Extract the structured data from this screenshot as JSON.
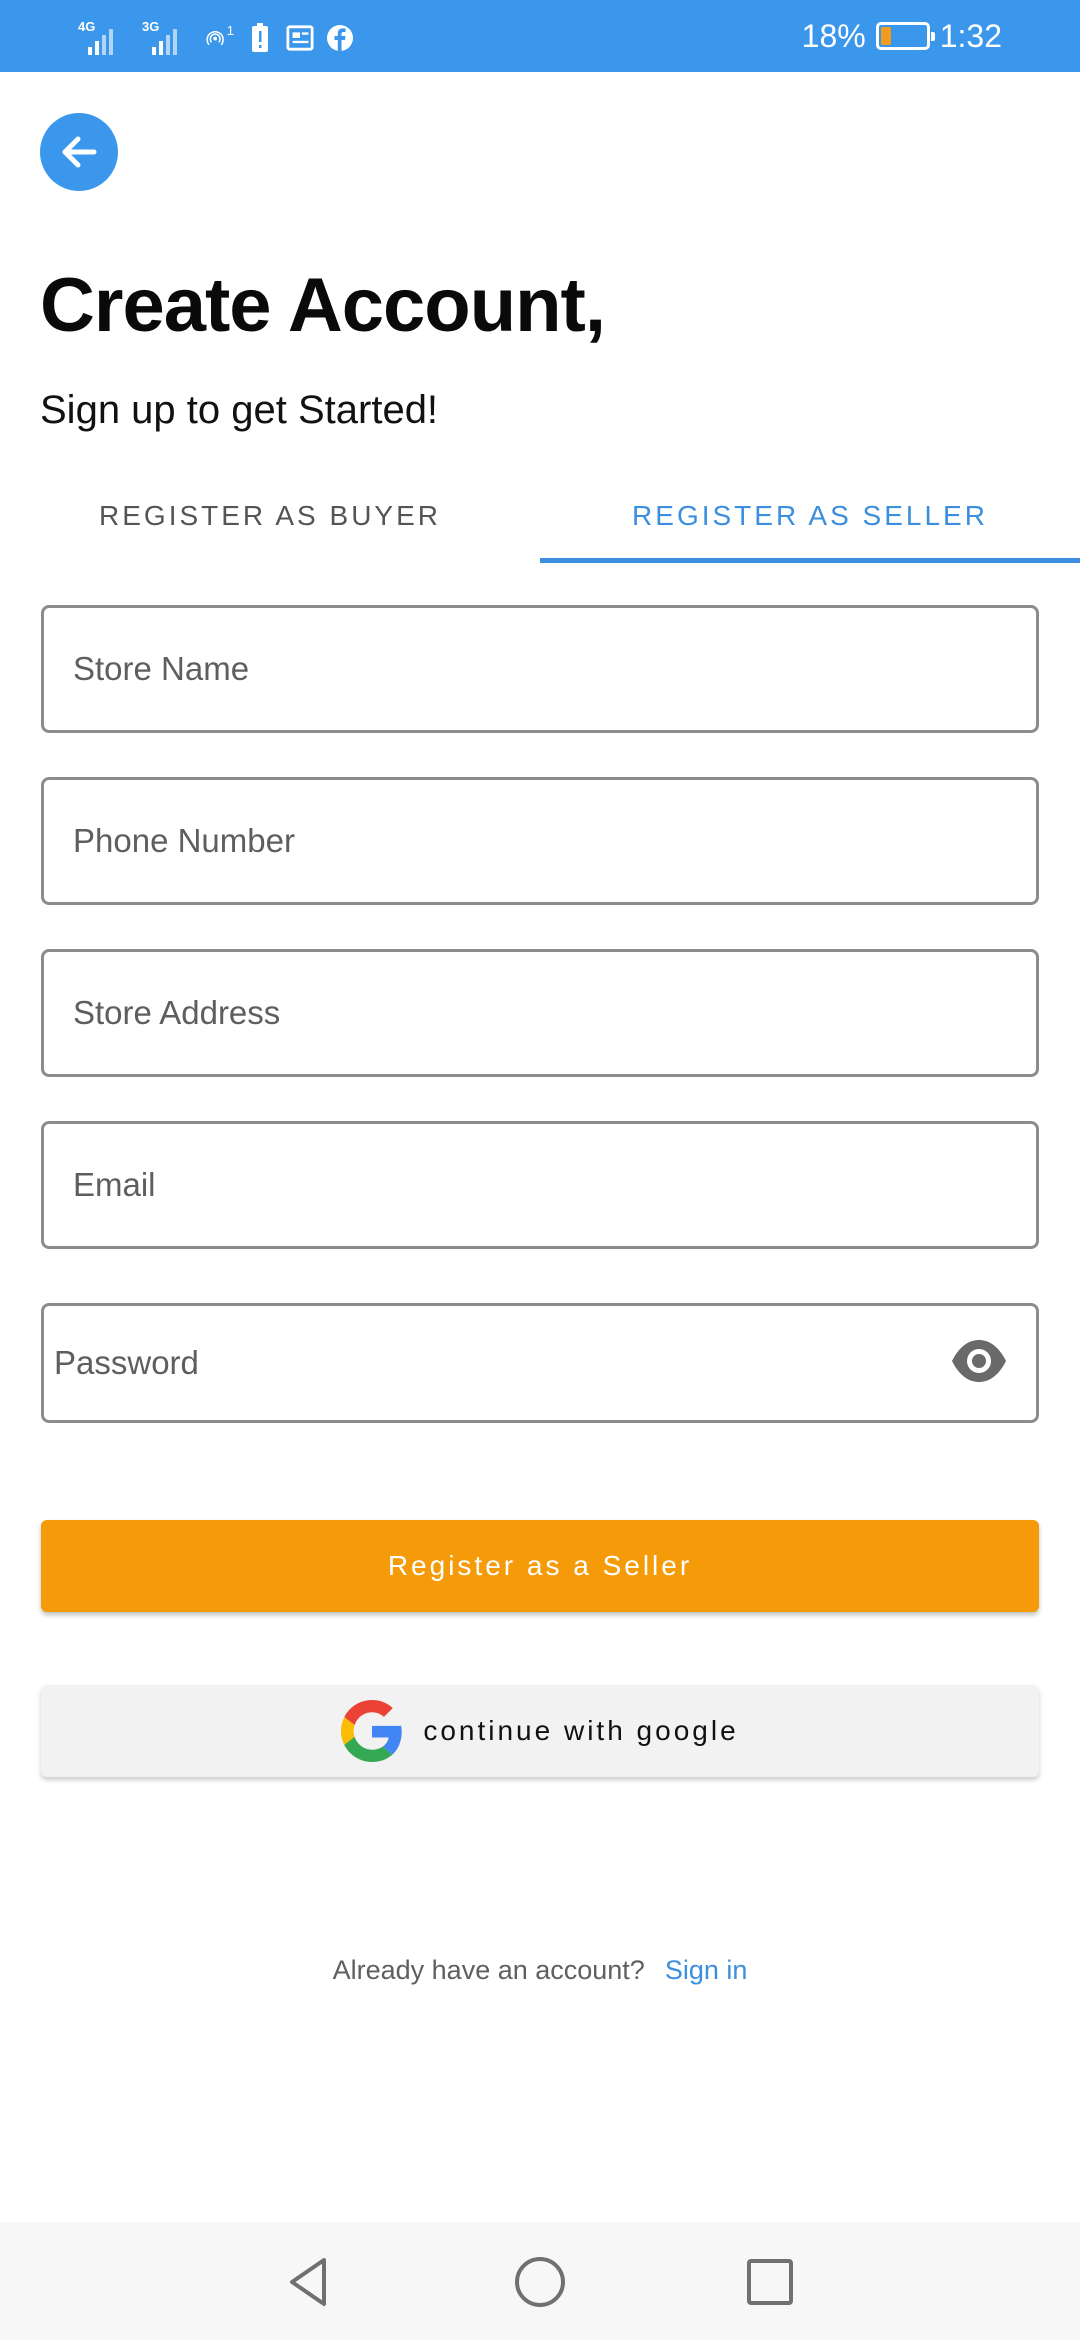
{
  "status_bar": {
    "network_1": "4G",
    "network_2": "3G",
    "hotspot_count": "1",
    "battery_percent": "18%",
    "battery_level": 0.18,
    "time": "1:32",
    "accent_color": "#3b97ec"
  },
  "header": {
    "back_icon": "arrow-left-icon",
    "title": "Create Account,",
    "subtitle": "Sign up to get Started!"
  },
  "tabs": [
    {
      "label": "REGISTER AS BUYER",
      "selected": false
    },
    {
      "label": "REGISTER AS SELLER",
      "selected": true
    }
  ],
  "form": {
    "store_name_placeholder": "Store Name",
    "phone_placeholder": "Phone Number",
    "address_placeholder": "Store Address",
    "email_placeholder": "Email",
    "password_placeholder": "Password",
    "password_toggle_icon": "eye-icon"
  },
  "buttons": {
    "register_label": "Register as a Seller",
    "register_color": "#f59a08",
    "google_label": "continue with google",
    "google_icon": "google-logo-icon"
  },
  "footer": {
    "question": "Already have an account?",
    "signin_label": "Sign in",
    "link_color": "#3b8fde"
  },
  "nav_bar": {
    "back_icon": "triangle-back-icon",
    "home_icon": "circle-home-icon",
    "recent_icon": "square-recents-icon"
  }
}
